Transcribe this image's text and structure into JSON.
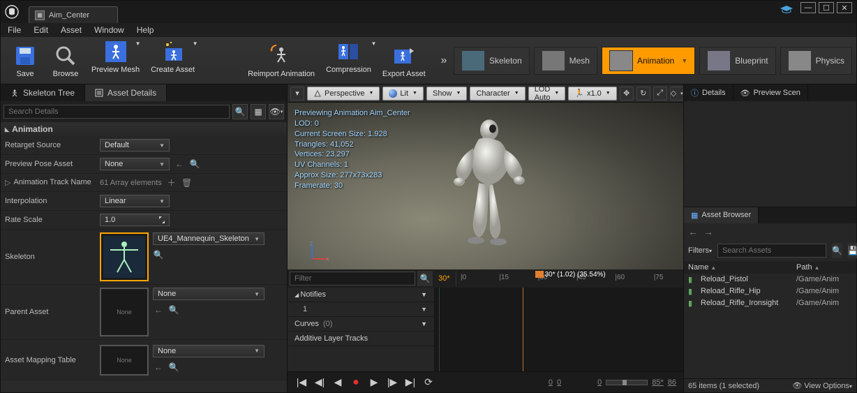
{
  "titlebar": {
    "tab_label": "Aim_Center"
  },
  "menu": {
    "file": "File",
    "edit": "Edit",
    "asset": "Asset",
    "window": "Window",
    "help": "Help"
  },
  "toolbar": {
    "save": "Save",
    "browse": "Browse",
    "previewMesh": "Preview Mesh",
    "createAsset": "Create Asset",
    "reimport": "Reimport Animation",
    "compression": "Compression",
    "exportAsset": "Export Asset"
  },
  "modes": {
    "skeleton": "Skeleton",
    "mesh": "Mesh",
    "animation": "Animation",
    "blueprint": "Blueprint",
    "physics": "Physics"
  },
  "leftTabs": {
    "skeletonTree": "Skeleton Tree",
    "assetDetails": "Asset Details"
  },
  "detailsSearch": {
    "placeholder": "Search Details"
  },
  "animSection": {
    "header": "Animation",
    "retarget_lbl": "Retarget Source",
    "retarget_val": "Default",
    "previewPose_lbl": "Preview Pose Asset",
    "previewPose_val": "None",
    "animTrack_lbl": "Animation Track Name",
    "animTrack_val": "61 Array elements",
    "interp_lbl": "Interpolation",
    "interp_val": "Linear",
    "rate_lbl": "Rate Scale",
    "rate_val": "1.0",
    "skeleton_lbl": "Skeleton",
    "skeleton_val": "UE4_Mannequin_Skeleton",
    "parent_lbl": "Parent Asset",
    "parent_val": "None",
    "parent_none": "None",
    "mapping_lbl": "Asset Mapping Table",
    "mapping_val": "None",
    "mapping_none": "None"
  },
  "viewport": {
    "perspective": "Perspective",
    "lit": "Lit",
    "show": "Show",
    "character": "Character",
    "lod": "LOD Auto",
    "speed": "x1.0",
    "overlay": {
      "l1": "Previewing Animation Aim_Center",
      "l2": "LOD: 0",
      "l3": "Current Screen Size: 1.928",
      "l4": "Triangles: 41,052",
      "l5": "Vertices: 23,297",
      "l6": "UV Channels: 1",
      "l7": "Approx Size: 277x73x283",
      "l8": "Framerate: 30"
    }
  },
  "timeline": {
    "filter": "Filter",
    "count": "30*",
    "ticks": [
      "|0",
      "|15",
      "|30",
      "|45",
      "|60",
      "|75"
    ],
    "playhead": "30* (1.02) (35.54%)",
    "notifies": "Notifies",
    "notify1": "1",
    "curves": "Curves",
    "curvesCount": "(0)",
    "additive": "Additive Layer Tracks",
    "r0": "0",
    "r1": "0",
    "r2": "0",
    "r3": "85*",
    "r4": "86"
  },
  "rightTabs": {
    "details": "Details",
    "preview": "Preview Scen"
  },
  "assetBrowser": {
    "tab": "Asset Browser",
    "filters": "Filters",
    "searchPH": "Search Assets",
    "colName": "Name",
    "colPath": "Path",
    "items": [
      {
        "name": "Reload_Pistol",
        "path": "/Game/Anim"
      },
      {
        "name": "Reload_Rifle_Hip",
        "path": "/Game/Anim"
      },
      {
        "name": "Reload_Rifle_Ironsight",
        "path": "/Game/Anim"
      }
    ],
    "status": "65 items (1 selected)",
    "viewopts": "View Options"
  }
}
